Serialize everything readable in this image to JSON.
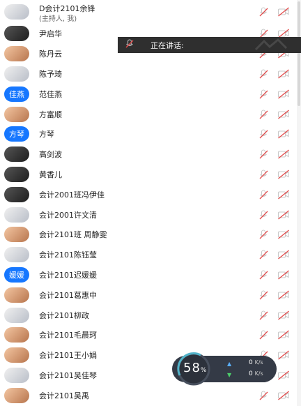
{
  "participants": [
    {
      "name": "D会计2101余锋",
      "subtitle": "(主持人, 我)",
      "avatar": {
        "type": "photo",
        "tone": "light"
      }
    },
    {
      "name": "尹启华",
      "avatar": {
        "type": "photo",
        "tone": "dark"
      }
    },
    {
      "name": "陈丹云",
      "avatar": {
        "type": "photo",
        "tone": "warm"
      }
    },
    {
      "name": "陈予琦",
      "avatar": {
        "type": "photo",
        "tone": "light"
      }
    },
    {
      "name": "范佳燕",
      "avatar": {
        "type": "text",
        "text": "佳燕"
      }
    },
    {
      "name": "方富顺",
      "avatar": {
        "type": "photo",
        "tone": "warm"
      }
    },
    {
      "name": "方琴",
      "avatar": {
        "type": "text",
        "text": "方琴"
      }
    },
    {
      "name": "高剑波",
      "avatar": {
        "type": "photo",
        "tone": "dark"
      }
    },
    {
      "name": "黄香儿",
      "avatar": {
        "type": "photo",
        "tone": "dark"
      }
    },
    {
      "name": "会计2001班冯伊佳",
      "avatar": {
        "type": "photo",
        "tone": "dark"
      }
    },
    {
      "name": "会计2001许文清",
      "avatar": {
        "type": "photo",
        "tone": "light"
      }
    },
    {
      "name": "会计2101班 周静雯",
      "avatar": {
        "type": "photo",
        "tone": "warm"
      }
    },
    {
      "name": "会计2101陈钰莹",
      "avatar": {
        "type": "photo",
        "tone": "light"
      }
    },
    {
      "name": "会计2101迟媛媛",
      "avatar": {
        "type": "text",
        "text": "媛媛"
      }
    },
    {
      "name": "会计2101葛惠中",
      "avatar": {
        "type": "photo",
        "tone": "warm"
      }
    },
    {
      "name": "会计2101柳政",
      "avatar": {
        "type": "photo",
        "tone": "light"
      }
    },
    {
      "name": "会计2101毛晨珂",
      "avatar": {
        "type": "photo",
        "tone": "warm"
      }
    },
    {
      "name": "会计2101王小娟",
      "avatar": {
        "type": "photo",
        "tone": "warm"
      }
    },
    {
      "name": "会计2101吴佳琴",
      "avatar": {
        "type": "photo",
        "tone": "light"
      }
    },
    {
      "name": "会计2101吴禹",
      "avatar": {
        "type": "photo",
        "tone": "warm"
      }
    }
  ],
  "speaking_banner": {
    "label": "正在讲话:",
    "icon": "muted-mic-icon"
  },
  "network_widget": {
    "usage_percent": "58",
    "percent_symbol": "%",
    "upload_value": "0",
    "upload_unit": "K/s",
    "download_value": "0",
    "download_unit": "K/s"
  },
  "colors": {
    "muted_red": "#e34b4b",
    "icon_gray": "#c8c8c8",
    "blue_avatar": "#1677ff",
    "banner_bg": "#2f2f2f"
  },
  "icons": [
    "mic-muted-icon",
    "camera-muted-icon"
  ]
}
